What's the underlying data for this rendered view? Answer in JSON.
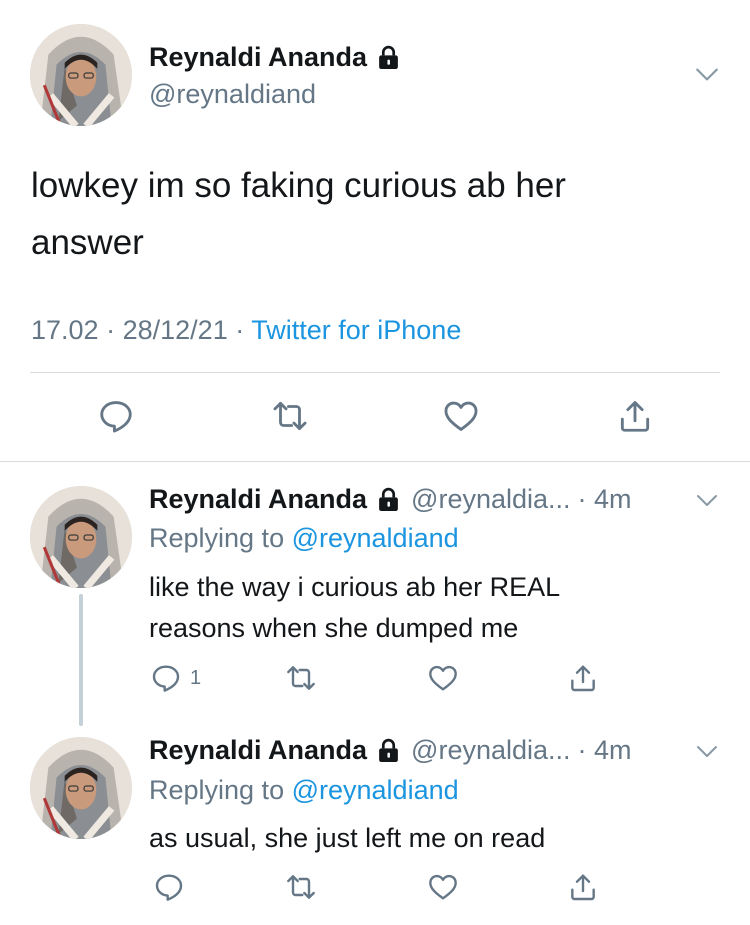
{
  "main_tweet": {
    "author_name": "Reynaldi Ananda",
    "handle": "@reynaldiand",
    "text": "lowkey im so faking curious ab her answer",
    "time": "17.02",
    "date": "28/12/21",
    "separator": "·",
    "source": "Twitter for iPhone"
  },
  "replies": [
    {
      "author_name": "Reynaldi Ananda",
      "handle_truncated": "@reynaldia...",
      "time": "· 4m",
      "replying_prefix": "Replying to",
      "replying_handle": "@reynaldiand",
      "text": "like the way i curious ab her REAL reasons when she dumped me",
      "reply_count": "1"
    },
    {
      "author_name": "Reynaldi Ananda",
      "handle_truncated": "@reynaldia...",
      "time": "· 4m",
      "replying_prefix": "Replying to",
      "replying_handle": "@reynaldiand",
      "text": "as usual, she just left me on read",
      "reply_count": ""
    }
  ],
  "icons": {
    "lock": "lock-icon",
    "chevron": "chevron-down-icon",
    "reply": "reply-icon",
    "retweet": "retweet-icon",
    "like": "heart-icon",
    "share": "share-icon"
  },
  "colors": {
    "text": "#14171a",
    "muted": "#657786",
    "link": "#1b95e0",
    "divider": "#d7dce0"
  }
}
